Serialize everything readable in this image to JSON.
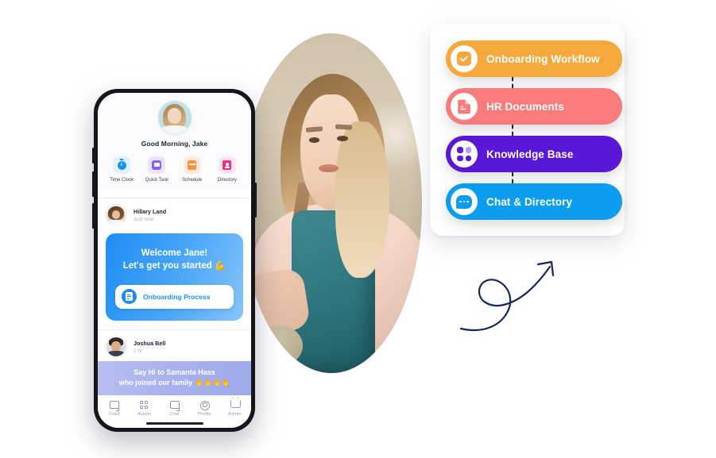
{
  "feature_card": {
    "items": [
      {
        "label": "Onboarding Workflow",
        "color": "#F5A93C",
        "icon": "check-circle-icon"
      },
      {
        "label": "HR Documents",
        "color": "#FA7B7B",
        "icon": "document-icon"
      },
      {
        "label": "Knowledge Base",
        "color": "#5B17D8",
        "icon": "grid-squares-icon"
      },
      {
        "label": "Chat & Directory",
        "color": "#0C9CF0",
        "icon": "chat-bubble-icon"
      }
    ]
  },
  "phone": {
    "greeting": "Good Morning, Jake",
    "quick_actions": [
      {
        "label": "Time Clock",
        "icon": "clock-icon",
        "bg": "#e3f0fe"
      },
      {
        "label": "Quick Task",
        "icon": "task-icon",
        "bg": "#ebe4fe"
      },
      {
        "label": "Schedule",
        "icon": "calendar-icon",
        "bg": "#fdeade"
      },
      {
        "label": "Directory",
        "icon": "contact-icon",
        "bg": "#fde3ef"
      }
    ],
    "posts": [
      {
        "author": "Hillary Land",
        "time": "Just now",
        "card": {
          "line1": "Welcome Jane!",
          "line2": "Let's get you started 💪",
          "button_label": "Onboarding Process"
        }
      },
      {
        "author": "Joshua Bell",
        "time": "1 hr",
        "banner": {
          "line1": "Say Hi to Samanta Hass",
          "line2": "who joined our family 👋👋👋👋"
        }
      }
    ],
    "tabbar": [
      {
        "label": "Feed",
        "icon": "feed-icon"
      },
      {
        "label": "Assets",
        "icon": "assets-grid-icon"
      },
      {
        "label": "Chat",
        "icon": "chat-icon"
      },
      {
        "label": "Profile",
        "icon": "profile-icon"
      },
      {
        "label": "Admin",
        "icon": "crown-icon"
      }
    ]
  }
}
